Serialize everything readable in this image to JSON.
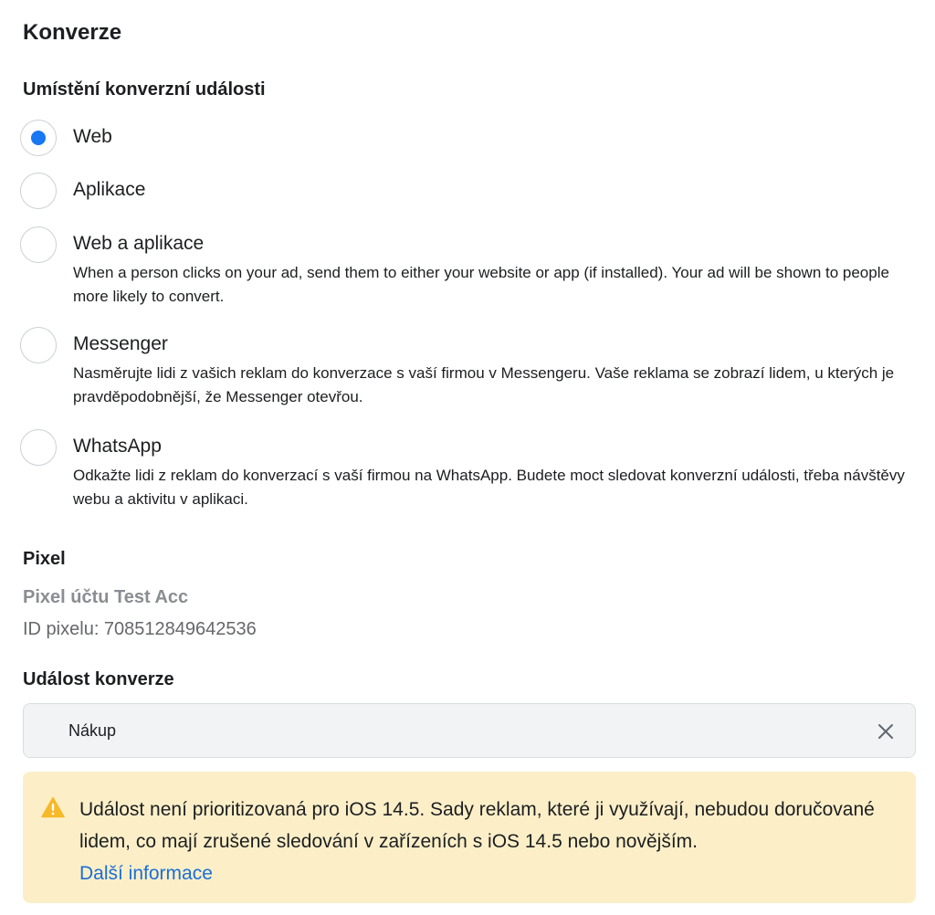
{
  "section_title": "Konverze",
  "placement": {
    "heading": "Umístění konverzní události",
    "options": [
      {
        "label": "Web",
        "checked": true,
        "description": ""
      },
      {
        "label": "Aplikace",
        "checked": false,
        "description": ""
      },
      {
        "label": "Web a aplikace",
        "checked": false,
        "description": "When a person clicks on your ad, send them to either your website or app (if installed). Your ad will be shown to people more likely to convert."
      },
      {
        "label": "Messenger",
        "checked": false,
        "description": "Nasměrujte lidi z vašich reklam do konverzace s vaší firmou v Messengeru. Vaše reklama se zobrazí lidem, u kterých je pravděpodobnější, že Messenger otevřou."
      },
      {
        "label": "WhatsApp",
        "checked": false,
        "description": "Odkažte lidi z reklam do konverzací s vaší firmou na WhatsApp. Budete moct sledovat konverzní události, třeba návštěvy webu a aktivitu v aplikaci."
      }
    ]
  },
  "pixel": {
    "heading": "Pixel",
    "name": "Pixel účtu Test Acc",
    "id_text": "ID pixelu: 708512849642536"
  },
  "conversion_event": {
    "heading": "Událost konverze",
    "selected_value": "Nákup",
    "clear_icon": "close-icon"
  },
  "warning": {
    "icon": "warning-icon",
    "text": "Událost není prioritizovaná pro iOS 14.5. Sady reklam, které ji využívají, nebudou doručované lidem, co mají zrušené sledování v zařízeních s iOS 14.5 nebo novějším.",
    "link_label": "Další informace"
  },
  "colors": {
    "accent": "#1877f2",
    "link": "#1a6ed8",
    "warning_bg": "#fcefc8",
    "warning_icon": "#f7b928"
  }
}
